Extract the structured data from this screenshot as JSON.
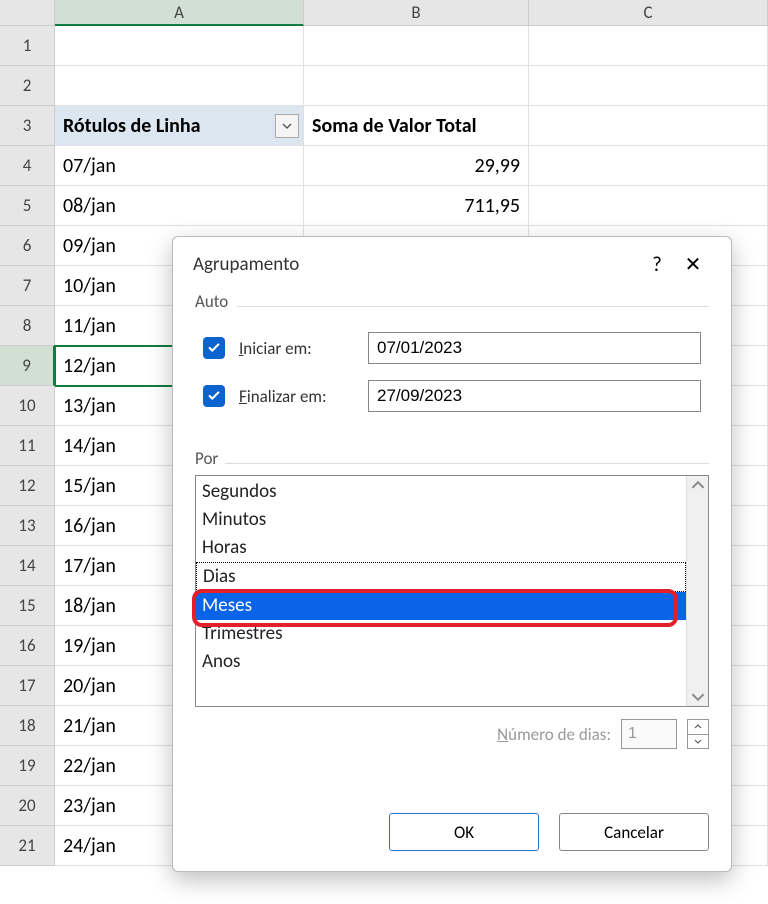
{
  "columns": [
    "A",
    "B",
    "C"
  ],
  "rows": [
    {
      "n": "1",
      "A": "",
      "B": ""
    },
    {
      "n": "2",
      "A": "",
      "B": ""
    },
    {
      "n": "3",
      "A": "Rótulos de Linha",
      "B": "Soma de Valor Total",
      "isHeader": true
    },
    {
      "n": "4",
      "A": "07/jan",
      "B": "29,99"
    },
    {
      "n": "5",
      "A": "08/jan",
      "B": "711,95"
    },
    {
      "n": "6",
      "A": "09/jan",
      "B": ""
    },
    {
      "n": "7",
      "A": "10/jan",
      "B": ""
    },
    {
      "n": "8",
      "A": "11/jan",
      "B": ""
    },
    {
      "n": "9",
      "A": "12/jan",
      "B": "",
      "selected": true
    },
    {
      "n": "10",
      "A": "13/jan",
      "B": ""
    },
    {
      "n": "11",
      "A": "14/jan",
      "B": ""
    },
    {
      "n": "12",
      "A": "15/jan",
      "B": ""
    },
    {
      "n": "13",
      "A": "16/jan",
      "B": ""
    },
    {
      "n": "14",
      "A": "17/jan",
      "B": ""
    },
    {
      "n": "15",
      "A": "18/jan",
      "B": ""
    },
    {
      "n": "16",
      "A": "19/jan",
      "B": ""
    },
    {
      "n": "17",
      "A": "20/jan",
      "B": ""
    },
    {
      "n": "18",
      "A": "21/jan",
      "B": ""
    },
    {
      "n": "19",
      "A": "22/jan",
      "B": ""
    },
    {
      "n": "20",
      "A": "23/jan",
      "B": ""
    },
    {
      "n": "21",
      "A": "24/jan",
      "B": ""
    }
  ],
  "dialog": {
    "title": "Agrupamento",
    "help": "?",
    "close": "✕",
    "auto_legend": "Auto",
    "start_label_pre": "I",
    "start_label": "niciar em:",
    "start_value": "07/01/2023",
    "end_label_pre": "F",
    "end_label": "inalizar em:",
    "end_value": "27/09/2023",
    "por_legend_pre": "P",
    "por_legend": "or",
    "list": [
      "Segundos",
      "Minutos",
      "Horas",
      "Dias",
      "Meses",
      "Trimestres",
      "Anos"
    ],
    "numdias_label_pre": "N",
    "numdias_label": "úmero de dias:",
    "numdias_value": "1",
    "ok": "OK",
    "cancel": "Cancelar"
  }
}
